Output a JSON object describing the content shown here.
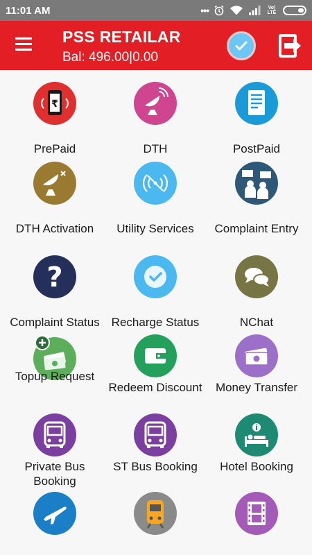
{
  "status_bar": {
    "time": "11:01 AM",
    "network_label": "Vo) LTE",
    "icons": [
      "more-dots-icon",
      "alarm-icon",
      "wifi-icon",
      "signal-icon",
      "volte-icon",
      "battery-icon"
    ]
  },
  "header": {
    "title": "PSS RETAILAR",
    "balance": "Bal: 496.00|0.00",
    "accent_color": "#e31e24"
  },
  "services": [
    {
      "label": "PrePaid",
      "icon": "mobile-rupee-icon",
      "color": "#e02f2f"
    },
    {
      "label": "DTH",
      "icon": "satellite-dish-icon",
      "color": "#d0458f"
    },
    {
      "label": "PostPaid",
      "icon": "bill-document-icon",
      "color": "#1b9ad8"
    },
    {
      "label": "DTH Activation",
      "icon": "dish-activation-icon",
      "color": "#9a7a30"
    },
    {
      "label": "Utility Services",
      "icon": "wireless-signal-icon",
      "color": "#4bb8f0"
    },
    {
      "label": "Complaint Entry",
      "icon": "protest-people-icon",
      "color": "#2d5878"
    },
    {
      "label": "Complaint Status",
      "icon": "question-mark-icon",
      "color": "#25305a"
    },
    {
      "label": "Recharge Status",
      "icon": "check-circle-icon",
      "color": "#4bb8f0"
    },
    {
      "label": "NChat",
      "icon": "chat-bubbles-icon",
      "color": "#767543"
    },
    {
      "label": "Topup Request",
      "icon": "money-add-icon",
      "color": "#5cae5a"
    },
    {
      "label": "Redeem Discount",
      "icon": "wallet-icon",
      "color": "#23a15c"
    },
    {
      "label": "Money Transfer",
      "icon": "cash-icon",
      "color": "#9c6fc8"
    },
    {
      "label": "Private Bus Booking",
      "icon": "bus-icon",
      "color": "#7b3fa0"
    },
    {
      "label": "ST Bus Booking",
      "icon": "bus-icon",
      "color": "#7b3fa0"
    },
    {
      "label": "Hotel Booking",
      "icon": "hotel-bed-icon",
      "color": "#1f8a73"
    },
    {
      "label": "",
      "icon": "airplane-icon",
      "color": "#1b7fc8"
    },
    {
      "label": "",
      "icon": "train-icon",
      "color": "#8a8a8a"
    },
    {
      "label": "",
      "icon": "film-strip-icon",
      "color": "#a45bb8"
    }
  ]
}
